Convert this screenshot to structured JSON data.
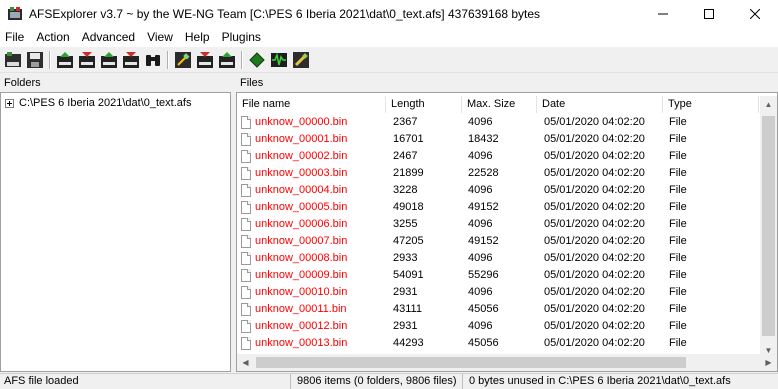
{
  "window": {
    "title": "AFSExplorer v3.7  ~ by the WE-NG Team [C:\\PES 6 Iberia 2021\\dat\\0_text.afs] 437639168 bytes",
    "minimize_icon": "minimize-icon",
    "maximize_icon": "maximize-icon",
    "close_icon": "close-icon"
  },
  "menu": [
    "File",
    "Action",
    "Advanced",
    "View",
    "Help",
    "Plugins"
  ],
  "toolbar": {
    "buttons": [
      "open-afs",
      "save",
      "import-file",
      "export-file",
      "import-dir",
      "export-dir",
      "search",
      "rebuild",
      "import-afs",
      "export-afs",
      "green-diamond",
      "waveform",
      "pencil-tool"
    ]
  },
  "folders": {
    "label": "Folders",
    "tree_root": "C:\\PES 6 Iberia 2021\\dat\\0_text.afs"
  },
  "files": {
    "label": "Files",
    "columns": [
      "File name",
      "Length",
      "Max. Size",
      "Date",
      "Type"
    ],
    "rows": [
      {
        "name": "unknow_00000.bin",
        "length": "2367",
        "max": "4096",
        "date": "05/01/2020 04:02:20",
        "type": "File"
      },
      {
        "name": "unknow_00001.bin",
        "length": "16701",
        "max": "18432",
        "date": "05/01/2020 04:02:20",
        "type": "File"
      },
      {
        "name": "unknow_00002.bin",
        "length": "2467",
        "max": "4096",
        "date": "05/01/2020 04:02:20",
        "type": "File"
      },
      {
        "name": "unknow_00003.bin",
        "length": "21899",
        "max": "22528",
        "date": "05/01/2020 04:02:20",
        "type": "File"
      },
      {
        "name": "unknow_00004.bin",
        "length": "3228",
        "max": "4096",
        "date": "05/01/2020 04:02:20",
        "type": "File"
      },
      {
        "name": "unknow_00005.bin",
        "length": "49018",
        "max": "49152",
        "date": "05/01/2020 04:02:20",
        "type": "File"
      },
      {
        "name": "unknow_00006.bin",
        "length": "3255",
        "max": "4096",
        "date": "05/01/2020 04:02:20",
        "type": "File"
      },
      {
        "name": "unknow_00007.bin",
        "length": "47205",
        "max": "49152",
        "date": "05/01/2020 04:02:20",
        "type": "File"
      },
      {
        "name": "unknow_00008.bin",
        "length": "2933",
        "max": "4096",
        "date": "05/01/2020 04:02:20",
        "type": "File"
      },
      {
        "name": "unknow_00009.bin",
        "length": "54091",
        "max": "55296",
        "date": "05/01/2020 04:02:20",
        "type": "File"
      },
      {
        "name": "unknow_00010.bin",
        "length": "2931",
        "max": "4096",
        "date": "05/01/2020 04:02:20",
        "type": "File"
      },
      {
        "name": "unknow_00011.bin",
        "length": "43111",
        "max": "45056",
        "date": "05/01/2020 04:02:20",
        "type": "File"
      },
      {
        "name": "unknow_00012.bin",
        "length": "2931",
        "max": "4096",
        "date": "05/01/2020 04:02:20",
        "type": "File"
      },
      {
        "name": "unknow_00013.bin",
        "length": "44293",
        "max": "45056",
        "date": "05/01/2020 04:02:20",
        "type": "File"
      }
    ]
  },
  "status": {
    "left": "AFS file loaded",
    "middle": "9806 items (0 folders, 9806 files)",
    "right": "0 bytes unused in C:\\PES 6 Iberia 2021\\dat\\0_text.afs"
  },
  "colors": {
    "filename_red": "#ff0000",
    "scroll_thumb": "#cdcdcd"
  }
}
